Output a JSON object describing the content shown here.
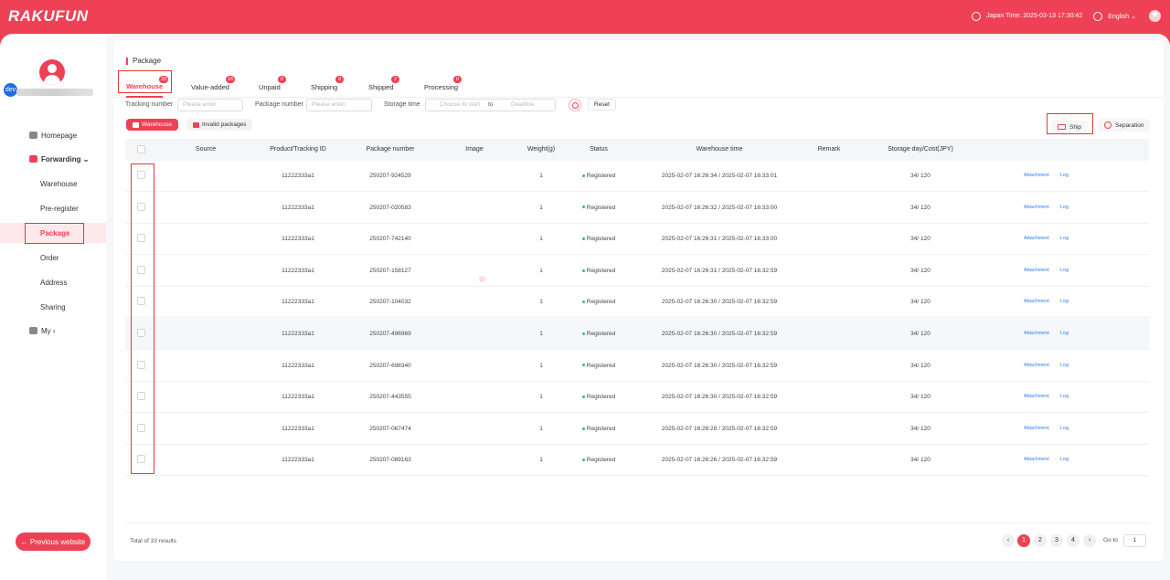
{
  "header": {
    "logo": "RAKUFUN",
    "time_label": "Japan Time: 2025-03-13 17:30:42",
    "language": "English ⌄"
  },
  "sidebar": {
    "user_badge": "dev",
    "items": [
      {
        "label": "Homepage"
      },
      {
        "label": "Forwarding ⌄"
      },
      {
        "label": "Warehouse"
      },
      {
        "label": "Pre-register"
      },
      {
        "label": "Package"
      },
      {
        "label": "Order"
      },
      {
        "label": "Address"
      },
      {
        "label": "Sharing"
      },
      {
        "label": "My ‹"
      }
    ],
    "prev_button": "← Previous website"
  },
  "main": {
    "breadcrumb": "Package",
    "tabs": [
      {
        "label": "Warehouse",
        "badge": "33"
      },
      {
        "label": "Value-added",
        "badge": "16"
      },
      {
        "label": "Unpaid",
        "badge": "0"
      },
      {
        "label": "Shipping",
        "badge": "0"
      },
      {
        "label": "Shipped",
        "badge": "2"
      },
      {
        "label": "Processing",
        "badge": "0"
      }
    ],
    "filters": {
      "tracking_label": "Tracking number",
      "tracking_placeholder": "Please enter",
      "package_label": "Package number",
      "package_placeholder": "Please enter",
      "storage_label": "Storage time",
      "start_placeholder": "Choose to start",
      "to_label": "to",
      "end_placeholder": "Deadline",
      "reset": "Reset"
    },
    "subtabs": {
      "warehouse": "Warehouse",
      "invalid": "Invalid packages"
    },
    "actions": {
      "ship": "Ship",
      "separation": "Separation"
    },
    "columns": [
      "Source",
      "Product/Tracking ID",
      "Package number",
      "Image",
      "Weight(g)",
      "Status",
      "Warehouse time",
      "Remark",
      "Storage day/Cost(JPY)"
    ],
    "rows": [
      {
        "tracking": "11222333a1",
        "package": "250207-924529",
        "weight": "1",
        "status": "Registered",
        "time": "2025-02-07 16:26:34 / 2025-02-07 16:33:01",
        "storage": "34/ 120",
        "attachment": "Attachment",
        "log": "Log"
      },
      {
        "tracking": "11222333a1",
        "package": "250207-020583",
        "weight": "1",
        "status": "Registered",
        "time": "2025-02-07 16:26:32 / 2025-02-07 16:33:00",
        "storage": "34/ 120",
        "attachment": "Attachment",
        "log": "Log"
      },
      {
        "tracking": "11222333a1",
        "package": "250207-742140",
        "weight": "1",
        "status": "Registered",
        "time": "2025-02-07 16:26:31 / 2025-02-07 16:33:00",
        "storage": "34/ 120",
        "attachment": "Attachment",
        "log": "Log"
      },
      {
        "tracking": "11222333a1",
        "package": "250207-158127",
        "weight": "1",
        "status": "Registered",
        "time": "2025-02-07 16:26:31 / 2025-02-07 16:32:59",
        "storage": "34/ 120",
        "attachment": "Attachment",
        "log": "Log"
      },
      {
        "tracking": "11222333a1",
        "package": "250207-104032",
        "weight": "1",
        "status": "Registered",
        "time": "2025-02-07 16:26:30 / 2025-02-07 16:32:59",
        "storage": "34/ 120",
        "attachment": "Attachment",
        "log": "Log"
      },
      {
        "tracking": "11222333a1",
        "package": "250207-496969",
        "weight": "1",
        "status": "Registered",
        "time": "2025-02-07 16:26:30 / 2025-02-07 16:32:59",
        "storage": "34/ 120",
        "attachment": "Attachment",
        "log": "Log"
      },
      {
        "tracking": "11222333a1",
        "package": "250207-698340",
        "weight": "1",
        "status": "Registered",
        "time": "2025-02-07 16:26:30 / 2025-02-07 16:32:59",
        "storage": "34/ 120",
        "attachment": "Attachment",
        "log": "Log"
      },
      {
        "tracking": "11222333a1",
        "package": "250207-443555",
        "weight": "1",
        "status": "Registered",
        "time": "2025-02-07 16:26:30 / 2025-02-07 16:32:59",
        "storage": "34/ 120",
        "attachment": "Attachment",
        "log": "Log"
      },
      {
        "tracking": "11222333a1",
        "package": "250207-067474",
        "weight": "1",
        "status": "Registered",
        "time": "2025-02-07 16:26:28 / 2025-02-07 16:32:59",
        "storage": "34/ 120",
        "attachment": "Attachment",
        "log": "Log"
      },
      {
        "tracking": "11222333a1",
        "package": "250207-089163",
        "weight": "1",
        "status": "Registered",
        "time": "2025-02-07 16:26:26 / 2025-02-07 16:32:59",
        "storage": "34/ 120",
        "attachment": "Attachment",
        "log": "Log"
      }
    ],
    "total": "Total of 33 results",
    "pagination": {
      "pages": [
        "1",
        "2",
        "3",
        "4"
      ],
      "current": "1",
      "prev": "‹",
      "next": "›",
      "goto_label": "Go to",
      "goto_value": "1"
    }
  },
  "colors": {
    "brand": "#ef4155",
    "link": "#2f7cf6",
    "status_ok": "#3dbb61"
  }
}
